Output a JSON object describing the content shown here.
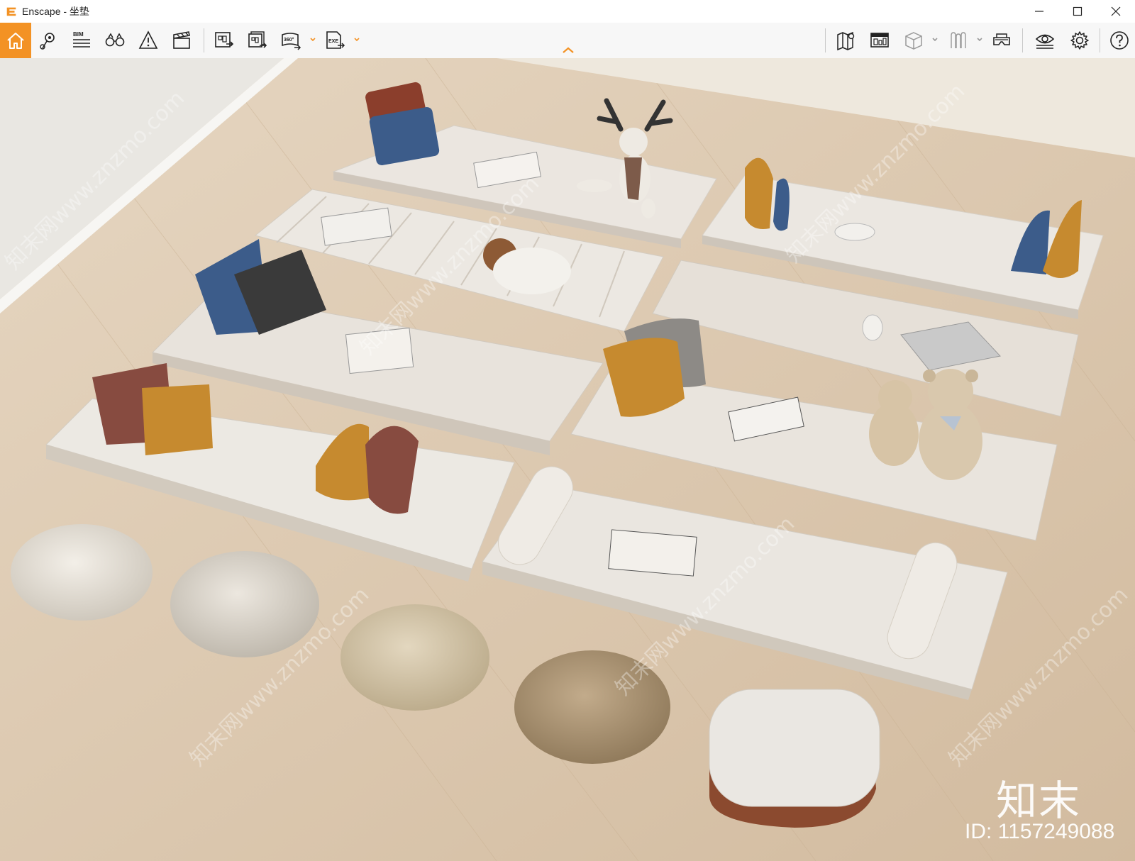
{
  "window": {
    "title": "Enscape - 坐垫"
  },
  "toolbar": {
    "left_tools": [
      "home-icon",
      "location-pin-icon",
      "bim-icon",
      "binoculars-icon",
      "warning-icon",
      "clapper-icon"
    ],
    "export_tools": [
      "screenshot-export-icon",
      "batch-render-icon",
      "panorama-360-icon",
      "exe-export-icon"
    ],
    "right_tools": [
      "map-icon",
      "asset-library-icon",
      "cube-view-icon",
      "materials-icon",
      "vr-headset-icon",
      "visibility-icon",
      "settings-icon",
      "help-icon"
    ],
    "bim_label": "BIM",
    "pano_label": "360°",
    "exe_label": "EXE"
  },
  "viewport": {
    "watermark_logo": "知末",
    "watermark_id": "ID: 1157249088",
    "watermark_text": "知末网www.znzmo.com"
  },
  "colors": {
    "accent": "#f39224",
    "floor": "#dcc7ad"
  }
}
